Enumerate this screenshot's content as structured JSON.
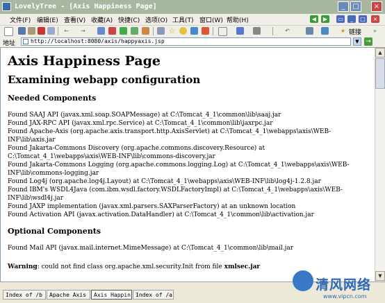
{
  "window": {
    "title": "LovelyTree - [Axis Happiness Page]"
  },
  "menu": [
    "文件(F)",
    "编辑(E)",
    "查看(V)",
    "收藏(A)",
    "快捷(C)",
    "选项(O)",
    "工具(T)",
    "窗口(W)",
    "帮助(H)"
  ],
  "toolbar": {
    "links_label": "链接"
  },
  "address": {
    "label": "地址",
    "url": "http://localhost:8080/axis/happyaxis.jsp"
  },
  "page": {
    "title": "Axis Happiness Page",
    "subtitle": "Examining webapp configuration",
    "needed_heading": "Needed Components",
    "needed": [
      "Found SAAJ API (javax.xml.soap.SOAPMessage) at C:\\Tomcat_4_1\\common\\lib\\saaj.jar",
      "Found JAX-RPC API (javax.xml.rpc.Service) at C:\\Tomcat_4_1\\common\\lib\\jaxrpc.jar",
      "Found Apache-Axis (org.apache.axis.transport.http.AxisServlet) at C:\\Tomcat_4_1\\webapps\\axis\\WEB-INF\\lib\\axis.jar",
      "Found Jakarta-Commons Discovery (org.apache.commons.discovery.Resource) at C:\\Tomcat_4_1\\webapps\\axis\\WEB-INF\\lib\\commons-discovery.jar",
      "Found Jakarta-Commons Logging (org.apache.commons.logging.Log) at C:\\Tomcat_4_1\\webapps\\axis\\WEB-INF\\lib\\commons-logging.jar",
      "Found Log4j (org.apache.log4j.Layout) at C:\\Tomcat_4_1\\webapps\\axis\\WEB-INF\\lib\\log4j-1.2.8.jar",
      "Found IBM's WSDL4Java (com.ibm.wsdl.factory.WSDLFactoryImpl) at C:\\Tomcat_4_1\\webapps\\axis\\WEB-INF\\lib\\wsdl4j.jar",
      "Found JAXP implementation (javax.xml.parsers.SAXParserFactory) at an unknown location",
      "Found Activation API (javax.activation.DataHandler) at C:\\Tomcat_4_1\\common\\lib\\activation.jar"
    ],
    "optional_heading": "Optional Components",
    "optional": [
      "Found Mail API (javax.mail.internet.MimeMessage) at C:\\Tomcat_4_1\\common\\lib\\mail.jar"
    ],
    "warning_label": "Warning",
    "warning_text": ": could not find class org.apache.xml.security.Init from file ",
    "warning_file": "xmlsec.jar"
  },
  "tabs": [
    {
      "label": "Index of /b",
      "active": false
    },
    {
      "label": "Apache Axis",
      "active": false
    },
    {
      "label": "Axis Happin",
      "active": true
    },
    {
      "label": "Index of /a",
      "active": false
    }
  ],
  "watermark": {
    "text": "清风网络",
    "url": "www.vipcn.com"
  },
  "colors": {
    "titlebar": "#a8b8a0",
    "nav_green": "#3a9a3a",
    "nav_blue": "#4a6ab8",
    "tab_active": "#ffffff"
  }
}
